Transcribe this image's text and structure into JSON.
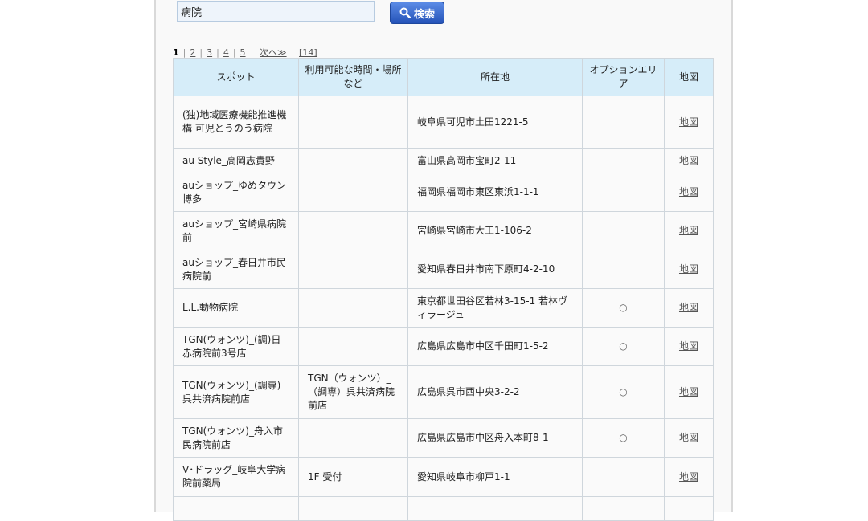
{
  "search": {
    "value": "病院",
    "button_label": "検索"
  },
  "pager": {
    "pages": [
      "1",
      "2",
      "3",
      "4",
      "5"
    ],
    "next_label": "次へ≫",
    "total_label": "[14]"
  },
  "table": {
    "headers": {
      "spot": "スポット",
      "hours": "利用可能な時間・場所など",
      "address": "所在地",
      "option": "オプションエリア",
      "map": "地図"
    },
    "rows": [
      {
        "spot": "(独)地域医療機能推進機構 可児とうのう病院",
        "hours": "",
        "address": "岐阜県可児市土田1221-5",
        "option": "",
        "map": "地図"
      },
      {
        "spot": "au Style_高岡志貴野",
        "hours": "",
        "address": "富山県高岡市宝町2-11",
        "option": "",
        "map": "地図"
      },
      {
        "spot": "auショップ_ゆめタウン博多",
        "hours": "",
        "address": "福岡県福岡市東区東浜1-1-1",
        "option": "",
        "map": "地図"
      },
      {
        "spot": "auショップ_宮崎県病院前",
        "hours": "",
        "address": "宮崎県宮崎市大工1-106-2",
        "option": "",
        "map": "地図"
      },
      {
        "spot": "auショップ_春日井市民病院前",
        "hours": "",
        "address": "愛知県春日井市南下原町4-2-10",
        "option": "",
        "map": "地図"
      },
      {
        "spot": "L.L.動物病院",
        "hours": "",
        "address": "東京都世田谷区若林3-15-1 若林ヴィラージュ",
        "option": "○",
        "map": "地図"
      },
      {
        "spot": "TGN(ウォンツ)_(調)日赤病院前3号店",
        "hours": "",
        "address": "広島県広島市中区千田町1-5-2",
        "option": "○",
        "map": "地図"
      },
      {
        "spot": "TGN(ウォンツ)_(調専)呉共済病院前店",
        "hours": "TGN（ウォンツ）_（調専）呉共済病院前店",
        "address": "広島県呉市西中央3-2-2",
        "option": "○",
        "map": "地図"
      },
      {
        "spot": "TGN(ウォンツ)_舟入市民病院前店",
        "hours": "",
        "address": "広島県広島市中区舟入本町8-1",
        "option": "○",
        "map": "地図"
      },
      {
        "spot": "V･ドラッグ_岐阜大学病院前薬局",
        "hours": "1F 受付",
        "address": "愛知県岐阜市柳戸1-1",
        "option": "",
        "map": "地図"
      },
      {
        "spot": "",
        "hours": "",
        "address": "",
        "option": "",
        "map": ""
      }
    ]
  }
}
